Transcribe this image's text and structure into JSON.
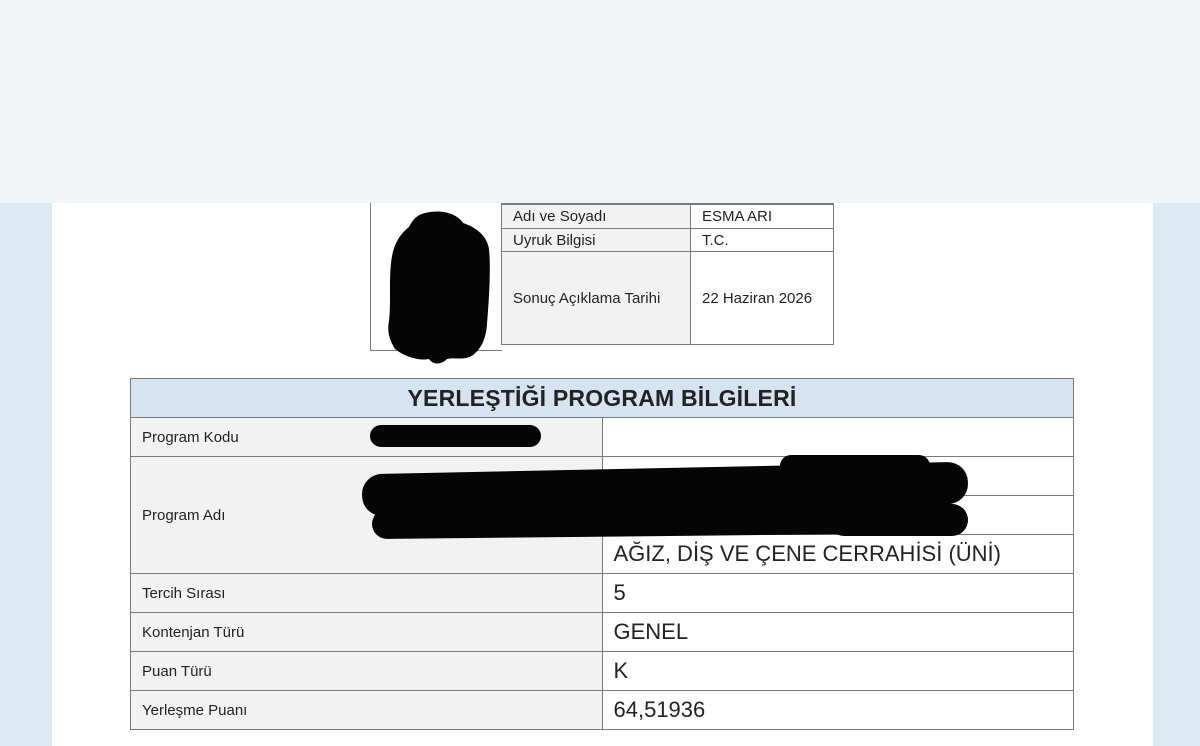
{
  "personal_info": {
    "rows": [
      {
        "label": "Adı ve Soyadı",
        "value": "ESMA ARI"
      },
      {
        "label": "Uyruk Bilgisi",
        "value": "T.C."
      },
      {
        "label": "Sonuç Açıklama Tarihi",
        "value": "22 Haziran 2026"
      }
    ]
  },
  "placement": {
    "title": "YERLEŞTİĞİ PROGRAM BİLGİLERİ",
    "program_code_label": "Program Kodu",
    "program_name_label": "Program Adı",
    "program_name_line3": "AĞIZ, DİŞ VE ÇENE CERRAHİSİ (ÜNİ)",
    "rows": [
      {
        "label": "Tercih Sırası",
        "value": "5"
      },
      {
        "label": "Kontenjan Türü",
        "value": "GENEL"
      },
      {
        "label": "Puan Türü",
        "value": "K"
      },
      {
        "label": "Yerleşme Puanı",
        "value": "64,51936"
      }
    ]
  },
  "colors": {
    "header_bg": "#d6e4f1",
    "label_bg": "#f2f2f2",
    "border": "#7a7a7a",
    "page_bg": "#dde9f3"
  }
}
